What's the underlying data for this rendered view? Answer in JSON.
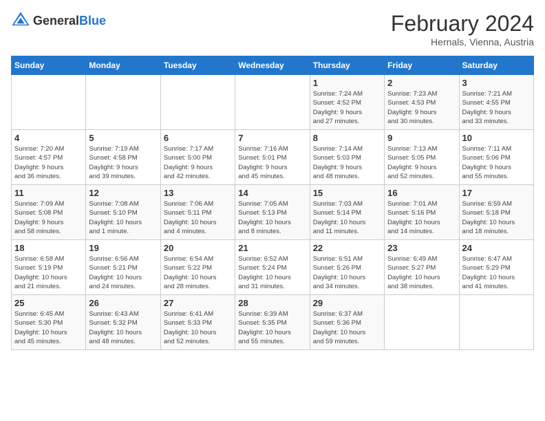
{
  "header": {
    "logo_general": "General",
    "logo_blue": "Blue",
    "month_title": "February 2024",
    "subtitle": "Hernals, Vienna, Austria"
  },
  "calendar": {
    "weekdays": [
      "Sunday",
      "Monday",
      "Tuesday",
      "Wednesday",
      "Thursday",
      "Friday",
      "Saturday"
    ],
    "weeks": [
      [
        {
          "day": "",
          "info": ""
        },
        {
          "day": "",
          "info": ""
        },
        {
          "day": "",
          "info": ""
        },
        {
          "day": "",
          "info": ""
        },
        {
          "day": "1",
          "info": "Sunrise: 7:24 AM\nSunset: 4:52 PM\nDaylight: 9 hours\nand 27 minutes."
        },
        {
          "day": "2",
          "info": "Sunrise: 7:23 AM\nSunset: 4:53 PM\nDaylight: 9 hours\nand 30 minutes."
        },
        {
          "day": "3",
          "info": "Sunrise: 7:21 AM\nSunset: 4:55 PM\nDaylight: 9 hours\nand 33 minutes."
        }
      ],
      [
        {
          "day": "4",
          "info": "Sunrise: 7:20 AM\nSunset: 4:57 PM\nDaylight: 9 hours\nand 36 minutes."
        },
        {
          "day": "5",
          "info": "Sunrise: 7:19 AM\nSunset: 4:58 PM\nDaylight: 9 hours\nand 39 minutes."
        },
        {
          "day": "6",
          "info": "Sunrise: 7:17 AM\nSunset: 5:00 PM\nDaylight: 9 hours\nand 42 minutes."
        },
        {
          "day": "7",
          "info": "Sunrise: 7:16 AM\nSunset: 5:01 PM\nDaylight: 9 hours\nand 45 minutes."
        },
        {
          "day": "8",
          "info": "Sunrise: 7:14 AM\nSunset: 5:03 PM\nDaylight: 9 hours\nand 48 minutes."
        },
        {
          "day": "9",
          "info": "Sunrise: 7:13 AM\nSunset: 5:05 PM\nDaylight: 9 hours\nand 52 minutes."
        },
        {
          "day": "10",
          "info": "Sunrise: 7:11 AM\nSunset: 5:06 PM\nDaylight: 9 hours\nand 55 minutes."
        }
      ],
      [
        {
          "day": "11",
          "info": "Sunrise: 7:09 AM\nSunset: 5:08 PM\nDaylight: 9 hours\nand 58 minutes."
        },
        {
          "day": "12",
          "info": "Sunrise: 7:08 AM\nSunset: 5:10 PM\nDaylight: 10 hours\nand 1 minute."
        },
        {
          "day": "13",
          "info": "Sunrise: 7:06 AM\nSunset: 5:11 PM\nDaylight: 10 hours\nand 4 minutes."
        },
        {
          "day": "14",
          "info": "Sunrise: 7:05 AM\nSunset: 5:13 PM\nDaylight: 10 hours\nand 8 minutes."
        },
        {
          "day": "15",
          "info": "Sunrise: 7:03 AM\nSunset: 5:14 PM\nDaylight: 10 hours\nand 11 minutes."
        },
        {
          "day": "16",
          "info": "Sunrise: 7:01 AM\nSunset: 5:16 PM\nDaylight: 10 hours\nand 14 minutes."
        },
        {
          "day": "17",
          "info": "Sunrise: 6:59 AM\nSunset: 5:18 PM\nDaylight: 10 hours\nand 18 minutes."
        }
      ],
      [
        {
          "day": "18",
          "info": "Sunrise: 6:58 AM\nSunset: 5:19 PM\nDaylight: 10 hours\nand 21 minutes."
        },
        {
          "day": "19",
          "info": "Sunrise: 6:56 AM\nSunset: 5:21 PM\nDaylight: 10 hours\nand 24 minutes."
        },
        {
          "day": "20",
          "info": "Sunrise: 6:54 AM\nSunset: 5:22 PM\nDaylight: 10 hours\nand 28 minutes."
        },
        {
          "day": "21",
          "info": "Sunrise: 6:52 AM\nSunset: 5:24 PM\nDaylight: 10 hours\nand 31 minutes."
        },
        {
          "day": "22",
          "info": "Sunrise: 6:51 AM\nSunset: 5:26 PM\nDaylight: 10 hours\nand 34 minutes."
        },
        {
          "day": "23",
          "info": "Sunrise: 6:49 AM\nSunset: 5:27 PM\nDaylight: 10 hours\nand 38 minutes."
        },
        {
          "day": "24",
          "info": "Sunrise: 6:47 AM\nSunset: 5:29 PM\nDaylight: 10 hours\nand 41 minutes."
        }
      ],
      [
        {
          "day": "25",
          "info": "Sunrise: 6:45 AM\nSunset: 5:30 PM\nDaylight: 10 hours\nand 45 minutes."
        },
        {
          "day": "26",
          "info": "Sunrise: 6:43 AM\nSunset: 5:32 PM\nDaylight: 10 hours\nand 48 minutes."
        },
        {
          "day": "27",
          "info": "Sunrise: 6:41 AM\nSunset: 5:33 PM\nDaylight: 10 hours\nand 52 minutes."
        },
        {
          "day": "28",
          "info": "Sunrise: 6:39 AM\nSunset: 5:35 PM\nDaylight: 10 hours\nand 55 minutes."
        },
        {
          "day": "29",
          "info": "Sunrise: 6:37 AM\nSunset: 5:36 PM\nDaylight: 10 hours\nand 59 minutes."
        },
        {
          "day": "",
          "info": ""
        },
        {
          "day": "",
          "info": ""
        }
      ]
    ]
  }
}
